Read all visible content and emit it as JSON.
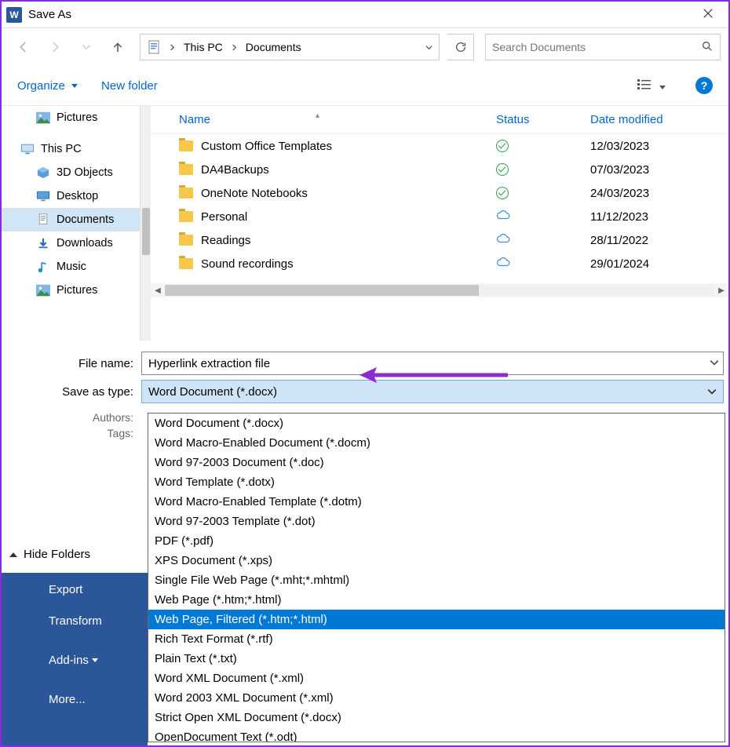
{
  "window": {
    "title": "Save As"
  },
  "breadcrumb": {
    "pc": "This PC",
    "folder": "Documents"
  },
  "search": {
    "placeholder": "Search Documents"
  },
  "toolbar": {
    "organize": "Organize",
    "newfolder": "New folder"
  },
  "sidebar": {
    "pictures_top": "Pictures",
    "thispc": "This PC",
    "items": [
      {
        "label": "3D Objects"
      },
      {
        "label": "Desktop"
      },
      {
        "label": "Documents"
      },
      {
        "label": "Downloads"
      },
      {
        "label": "Music"
      },
      {
        "label": "Pictures"
      }
    ]
  },
  "columns": {
    "name": "Name",
    "status": "Status",
    "date": "Date modified"
  },
  "rows": [
    {
      "name": "Custom Office Templates",
      "status": "synced",
      "date": "12/03/2023"
    },
    {
      "name": "DA4Backups",
      "status": "synced",
      "date": "07/03/2023"
    },
    {
      "name": "OneNote Notebooks",
      "status": "synced",
      "date": "24/03/2023"
    },
    {
      "name": "Personal",
      "status": "cloud",
      "date": "11/12/2023"
    },
    {
      "name": "Readings",
      "status": "cloud",
      "date": "28/11/2022"
    },
    {
      "name": "Sound recordings",
      "status": "cloud",
      "date": "29/01/2024"
    }
  ],
  "form": {
    "filename_label": "File name:",
    "filename": "Hyperlink extraction file",
    "type_label": "Save as type:",
    "type_selected": "Word Document (*.docx)",
    "authors_label": "Authors:",
    "tags_label": "Tags:"
  },
  "types": [
    "Word Document (*.docx)",
    "Word Macro-Enabled Document (*.docm)",
    "Word 97-2003 Document (*.doc)",
    "Word Template (*.dotx)",
    "Word Macro-Enabled Template (*.dotm)",
    "Word 97-2003 Template (*.dot)",
    "PDF (*.pdf)",
    "XPS Document (*.xps)",
    "Single File Web Page (*.mht;*.mhtml)",
    "Web Page (*.htm;*.html)",
    "Web Page, Filtered (*.htm;*.html)",
    "Rich Text Format (*.rtf)",
    "Plain Text (*.txt)",
    "Word XML Document (*.xml)",
    "Word 2003 XML Document (*.xml)",
    "Strict Open XML Document (*.docx)",
    "OpenDocument Text (*.odt)"
  ],
  "type_highlight_index": 10,
  "hide_folders": "Hide Folders",
  "backstage": {
    "export": "Export",
    "transform": "Transform",
    "addins": "Add-ins",
    "more": "More..."
  }
}
